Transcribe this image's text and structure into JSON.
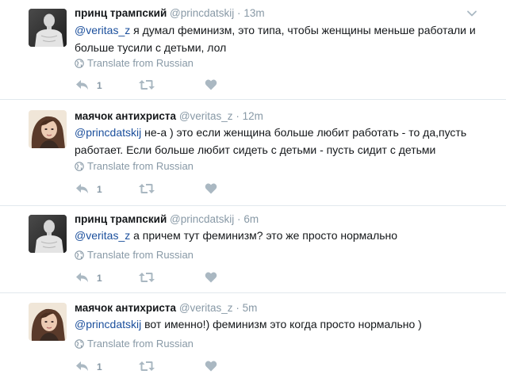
{
  "tweets": [
    {
      "name": "принц трампский",
      "handle": "@princdatskij",
      "sep": "·",
      "time": "13m",
      "mention": "@veritas_z",
      "text": " я думал феминизм, это типа, чтобы женщины меньше работали и больше тусили с детьми, лол",
      "translate": "Translate from Russian",
      "reply_count": "1"
    },
    {
      "name": "маячок антихриста",
      "handle": "@veritas_z",
      "sep": "·",
      "time": "12m",
      "mention": "@princdatskij",
      "text": " не-а ) это если женщина больше любит работать - то да,пусть работает. Если больше любит сидеть с детьми - пусть сидит с детьми",
      "translate": "Translate from Russian",
      "reply_count": "1"
    },
    {
      "name": "принц трампский",
      "handle": "@princdatskij",
      "sep": "·",
      "time": "6m",
      "mention": "@veritas_z",
      "text": " а причем тут феминизм? это же просто нормально",
      "translate": "Translate from Russian",
      "reply_count": "1"
    },
    {
      "name": "маячок антихриста",
      "handle": "@veritas_z",
      "sep": "·",
      "time": "5m",
      "mention": "@princdatskij",
      "text": " вот именно!) феминизм это когда просто нормально )",
      "translate": "Translate from Russian",
      "reply_count": "1"
    }
  ],
  "icons": {
    "reply": "reply-icon",
    "retweet": "retweet-icon",
    "like": "heart-icon",
    "translate": "globe-icon",
    "menu": "chevron-down-icon"
  },
  "colors": {
    "mention": "#1b4f9c",
    "muted": "#8899a6",
    "divider": "#e1e8ed"
  }
}
